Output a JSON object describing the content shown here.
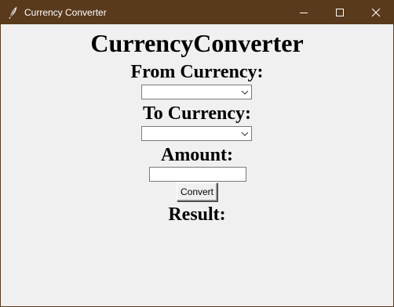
{
  "window": {
    "title": "Currency Converter",
    "icon": "feather-icon",
    "titlebar_color": "#5a3a1c",
    "controls": [
      "minimize-icon",
      "maximize-icon",
      "close-icon"
    ]
  },
  "app": {
    "heading": "CurrencyConverter",
    "from_label": "From Currency:",
    "from_value": "",
    "to_label": "To Currency:",
    "to_value": "",
    "amount_label": "Amount:",
    "amount_value": "",
    "convert_label": "Convert",
    "result_label": "Result:"
  }
}
